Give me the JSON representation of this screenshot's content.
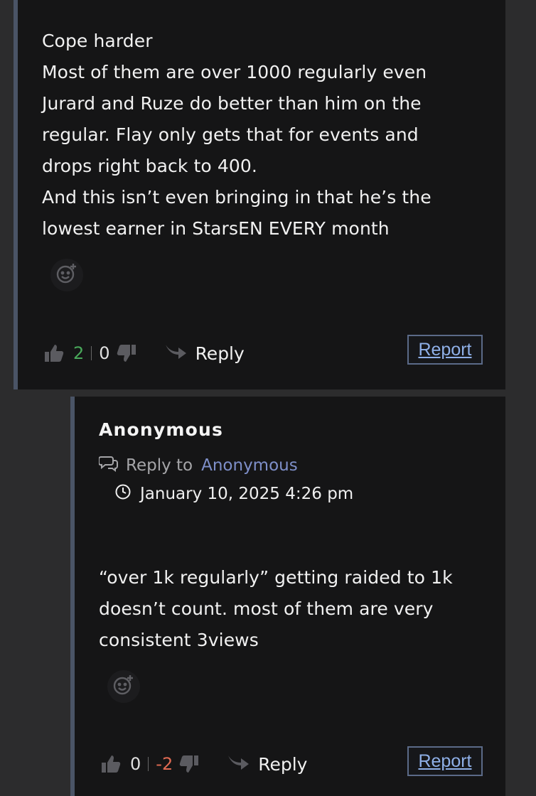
{
  "comment1": {
    "paragraphs": [
      "Cope harder",
      "Most of them are over 1000 regularly even Jurard and Ruze do better than him on the regular. Flay only gets that for events and drops right back to 400.",
      "And this isn’t even bringing in that he’s the lowest earner in StarsEN EVERY month"
    ],
    "upvotes": "2",
    "downvotes": "0",
    "reply_label": "Reply",
    "report_label": "Report"
  },
  "comment2": {
    "author": "Anonymous",
    "reply_to_label": "Reply to",
    "reply_to_name": "Anonymous",
    "date": "January 10, 2025 4:26 pm",
    "paragraphs": [
      "“over 1k regularly” getting raided to 1k doesn’t count. most of them are very consistent 3views"
    ],
    "upvotes": "0",
    "downvotes": "-2",
    "reply_label": "Reply",
    "report_label": "Report"
  },
  "colors": {
    "upvote_count": "#49a85a",
    "negative_count": "#e06a52",
    "link": "#7e8fc9",
    "report_link": "#8fb0e8"
  },
  "icons": [
    "thumbs-up-icon",
    "thumbs-down-icon",
    "reply-arrow-icon",
    "add-reaction-icon",
    "speech-bubbles-icon",
    "clock-icon"
  ]
}
